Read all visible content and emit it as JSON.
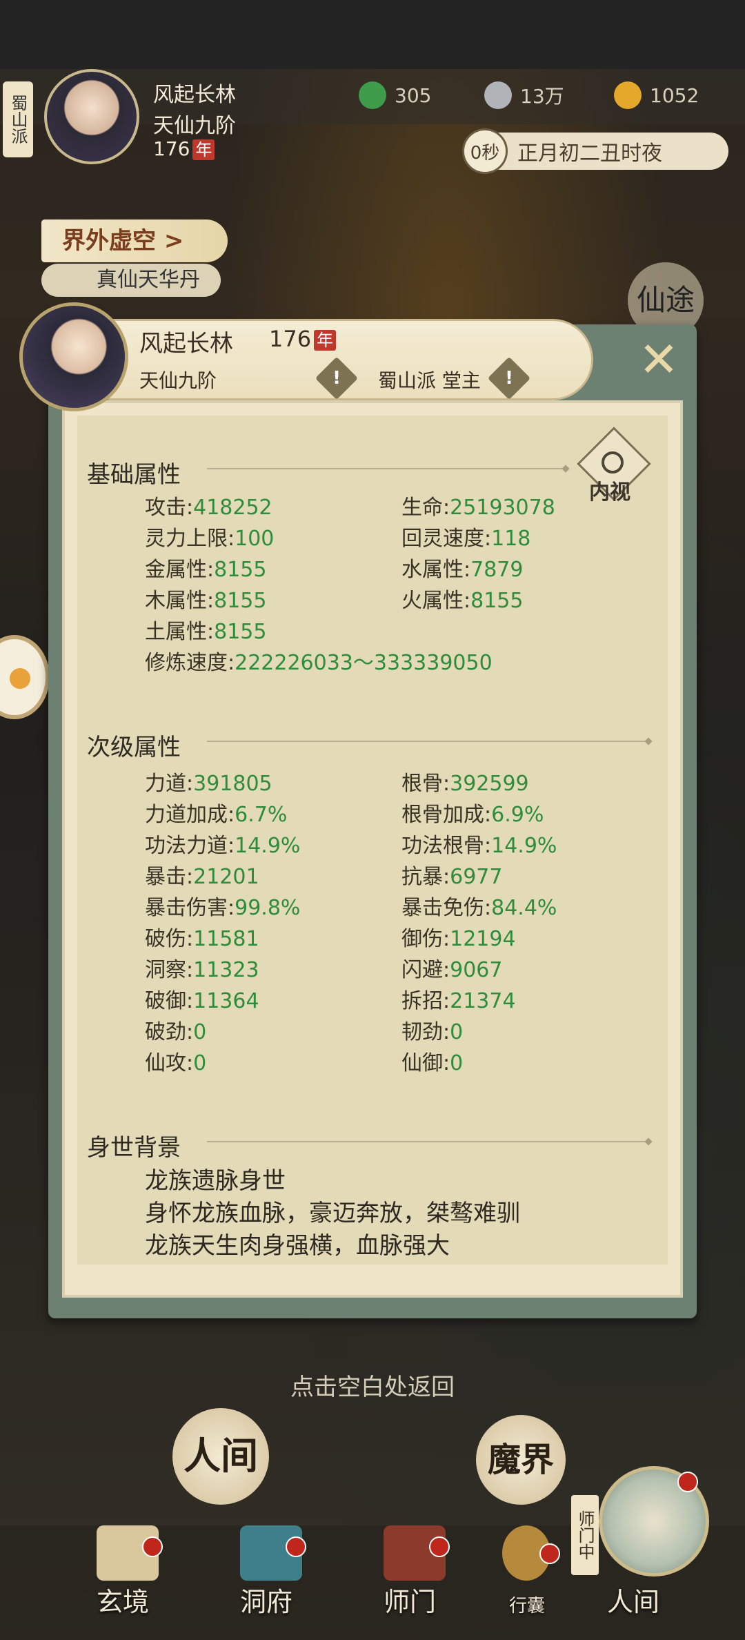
{
  "hud": {
    "sect_vertical": "蜀山派",
    "player_name": "风起长林",
    "player_rank": "天仙九阶",
    "player_age": "176",
    "age_unit": "年",
    "resource_1": "305",
    "resource_2": "13万",
    "resource_3": "1052",
    "time_seconds": "0秒",
    "time_text": "正月初二丑时夜",
    "realm_button": "界外虚空 >",
    "item_pill": "真仙天华丹",
    "side_badge": "仙途"
  },
  "panel": {
    "name": "风起长林",
    "age": "176",
    "age_unit": "年",
    "rank": "天仙九阶",
    "sect_role": "蜀山派 堂主",
    "close_glyph": "✕",
    "inner_view": "内视",
    "basic": {
      "title": "基础属性",
      "items": [
        {
          "label": "攻击",
          "value": "418252"
        },
        {
          "label": "生命",
          "value": "25193078"
        },
        {
          "label": "灵力上限",
          "value": "100"
        },
        {
          "label": "回灵速度",
          "value": "118"
        },
        {
          "label": "金属性",
          "value": "8155"
        },
        {
          "label": "水属性",
          "value": "7879"
        },
        {
          "label": "木属性",
          "value": "8155"
        },
        {
          "label": "火属性",
          "value": "8155"
        },
        {
          "label": "土属性",
          "value": "8155"
        },
        {
          "label": "修炼速度",
          "value": "222226033～333339050"
        }
      ]
    },
    "secondary": {
      "title": "次级属性",
      "items": [
        {
          "label": "力道",
          "value": "391805"
        },
        {
          "label": "根骨",
          "value": "392599"
        },
        {
          "label": "力道加成",
          "value": "6.7%"
        },
        {
          "label": "根骨加成",
          "value": "6.9%"
        },
        {
          "label": "功法力道",
          "value": "14.9%"
        },
        {
          "label": "功法根骨",
          "value": "14.9%"
        },
        {
          "label": "暴击",
          "value": "21201"
        },
        {
          "label": "抗暴",
          "value": "6977"
        },
        {
          "label": "暴击伤害",
          "value": "99.8%"
        },
        {
          "label": "暴击免伤",
          "value": "84.4%"
        },
        {
          "label": "破伤",
          "value": "11581"
        },
        {
          "label": "御伤",
          "value": "12194"
        },
        {
          "label": "洞察",
          "value": "11323"
        },
        {
          "label": "闪避",
          "value": "9067"
        },
        {
          "label": "破御",
          "value": "11364"
        },
        {
          "label": "拆招",
          "value": "21374"
        },
        {
          "label": "破劲",
          "value": "0"
        },
        {
          "label": "韧劲",
          "value": "0"
        },
        {
          "label": "仙攻",
          "value": "0"
        },
        {
          "label": "仙御",
          "value": "0"
        }
      ]
    },
    "background": {
      "title": "身世背景",
      "lines": [
        "龙族遗脉身世",
        "身怀龙族血脉，豪迈奔放，桀骜难驯",
        "龙族天生肉身强横，血脉强大"
      ]
    }
  },
  "back_hint": "点击空白处返回",
  "bottom": {
    "human_world": "人间",
    "demon_world": "魔界",
    "nav": [
      "玄境",
      "洞府",
      "师门",
      "行囊",
      "人间"
    ],
    "shimen_tag": "师门中"
  },
  "colors": {
    "attr_value": "#2f8c3b",
    "panel_frame": "#6c8171",
    "age_badge": "#c0382b"
  }
}
